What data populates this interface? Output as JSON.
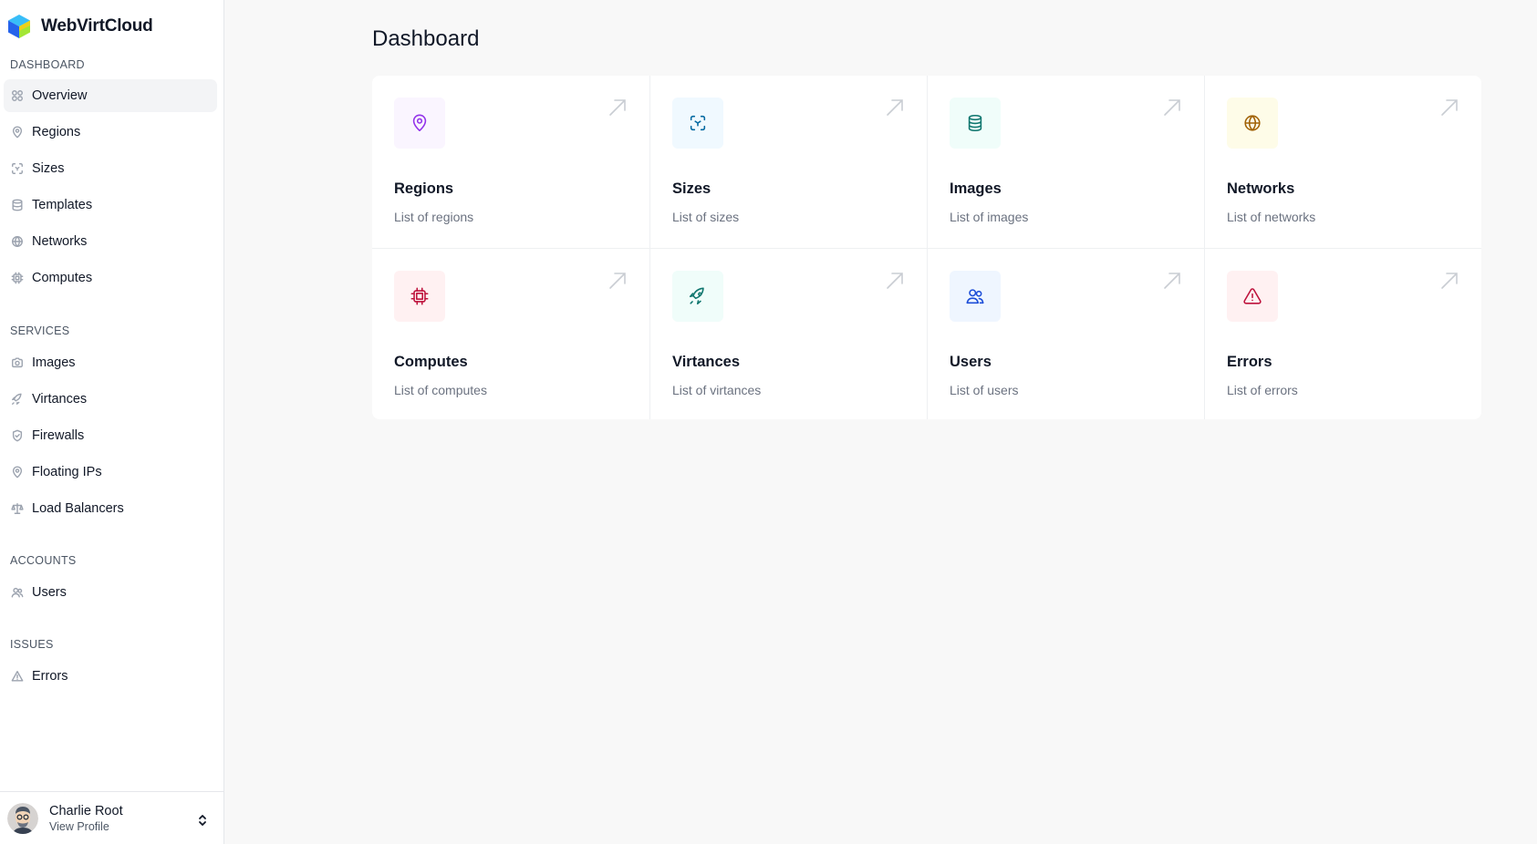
{
  "brand": {
    "name": "WebVirtCloud"
  },
  "sidebar": {
    "sections": [
      {
        "label": "DASHBOARD",
        "items": [
          {
            "label": "Overview",
            "icon": "grid-icon",
            "active": true
          },
          {
            "label": "Regions",
            "icon": "map-pin-icon"
          },
          {
            "label": "Sizes",
            "icon": "scan-icon"
          },
          {
            "label": "Templates",
            "icon": "database-icon"
          },
          {
            "label": "Networks",
            "icon": "globe-icon"
          },
          {
            "label": "Computes",
            "icon": "chip-icon"
          }
        ]
      },
      {
        "label": "SERVICES",
        "items": [
          {
            "label": "Images",
            "icon": "camera-icon"
          },
          {
            "label": "Virtances",
            "icon": "rocket-icon"
          },
          {
            "label": "Firewalls",
            "icon": "shield-icon"
          },
          {
            "label": "Floating IPs",
            "icon": "map-pin-icon"
          },
          {
            "label": "Load Balancers",
            "icon": "scale-icon"
          }
        ]
      },
      {
        "label": "ACCOUNTS",
        "items": [
          {
            "label": "Users",
            "icon": "users-icon"
          }
        ]
      },
      {
        "label": "ISSUES",
        "items": [
          {
            "label": "Errors",
            "icon": "warning-icon"
          }
        ]
      }
    ]
  },
  "profile": {
    "name": "Charlie Root",
    "subtitle": "View Profile"
  },
  "main": {
    "title": "Dashboard",
    "cards": [
      {
        "title": "Regions",
        "description": "List of regions",
        "icon": "map-pin-icon",
        "color": "#9333ea",
        "bg": "#faf5ff"
      },
      {
        "title": "Sizes",
        "description": "List of sizes",
        "icon": "scan-icon",
        "color": "#0369a1",
        "bg": "#f0f9ff"
      },
      {
        "title": "Images",
        "description": "List of images",
        "icon": "database-icon",
        "color": "#0f766e",
        "bg": "#f0fdfa"
      },
      {
        "title": "Networks",
        "description": "List of networks",
        "icon": "globe-icon",
        "color": "#a16207",
        "bg": "#fefce8"
      },
      {
        "title": "Computes",
        "description": "List of computes",
        "icon": "chip-icon",
        "color": "#be123c",
        "bg": "#fff1f2"
      },
      {
        "title": "Virtances",
        "description": "List of virtances",
        "icon": "rocket-icon",
        "color": "#0f766e",
        "bg": "#f0fdfa"
      },
      {
        "title": "Users",
        "description": "List of users",
        "icon": "users-icon",
        "color": "#1d4ed8",
        "bg": "#eff6ff"
      },
      {
        "title": "Errors",
        "description": "List of errors",
        "icon": "warning-icon",
        "color": "#be123c",
        "bg": "#fff1f2"
      }
    ]
  }
}
